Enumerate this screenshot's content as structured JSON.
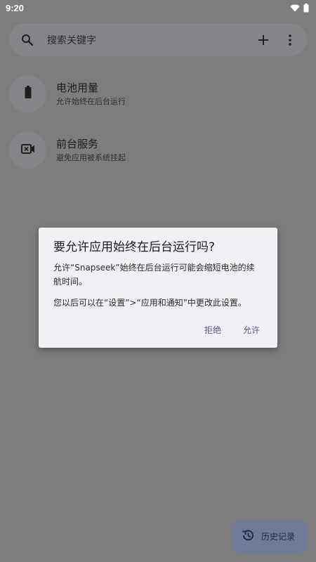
{
  "status_bar": {
    "time": "9:20",
    "icons": [
      "wifi-icon",
      "battery-icon"
    ]
  },
  "search": {
    "placeholder": "搜索关键字",
    "icons": [
      "search-icon",
      "add-icon",
      "more-vert-icon"
    ]
  },
  "features": [
    {
      "title": "电池用量",
      "description": "允许始终在后台运行",
      "icon": "battery-icon"
    },
    {
      "title": "前台服务",
      "description": "避免应用被系统挂起",
      "icon": "video-icon"
    }
  ],
  "dialog": {
    "title": "要允许应用始终在后台运行吗?",
    "message": "允许“Snapseek”始终在后台运行可能会缩短电池的续航时间。",
    "message2": "您以后可以在“设置”>“应用和通知”中更改此设置。",
    "deny_label": "拒绝",
    "allow_label": "允许"
  },
  "fab": {
    "label": "历史记录",
    "icon": "history-icon"
  },
  "colors": {
    "scrim_background": "#7d7d7d",
    "surface": "#858488",
    "dialog_background": "#f3f0f5",
    "dialog_button": "#4d5a8c",
    "fab_background": "#6f7c98"
  }
}
